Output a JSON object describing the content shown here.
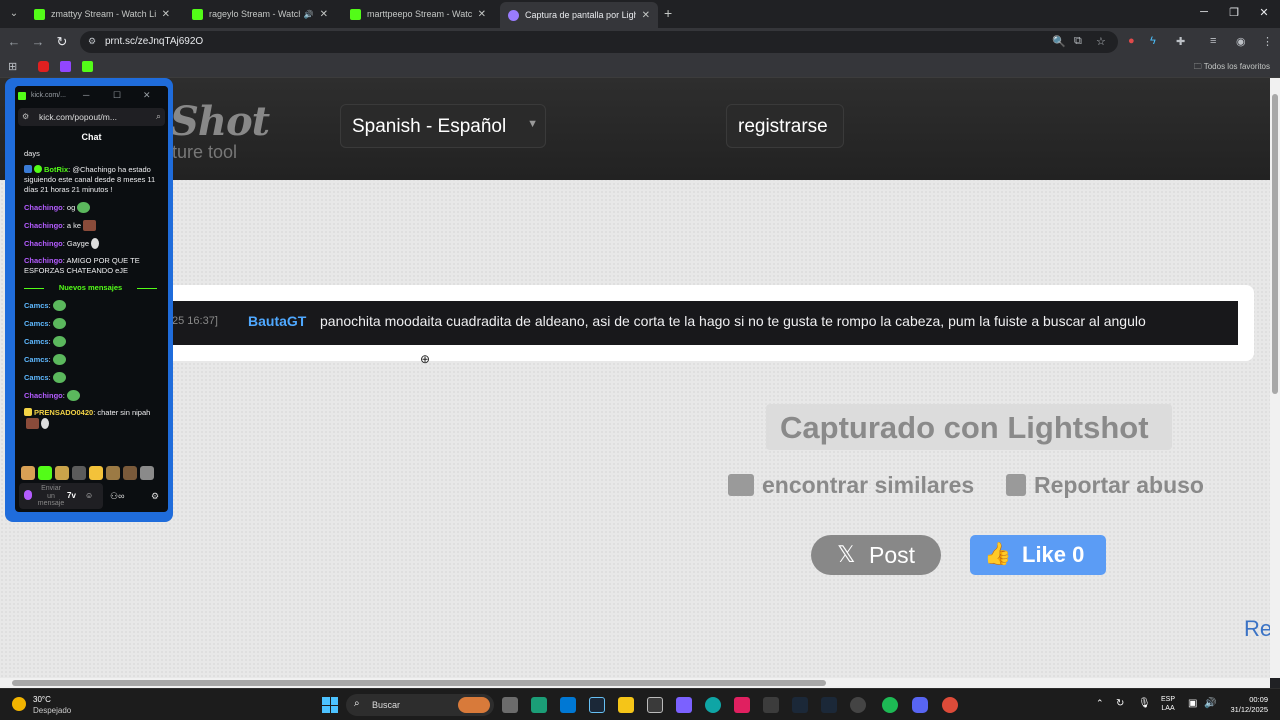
{
  "browser": {
    "tabs": [
      {
        "title": "zmattyy Stream - Watch Live on",
        "favicon": "kick-icon",
        "active": false
      },
      {
        "title": "rageylo Stream - Watch Live",
        "favicon": "kick-icon",
        "active": false,
        "audio": true
      },
      {
        "title": "marttpeepo Stream - Watch Live",
        "favicon": "kick-icon",
        "active": false
      },
      {
        "title": "Captura de pantalla por Lightshot",
        "favicon": "lightshot-icon",
        "active": true
      }
    ],
    "new_tab_symbol": "+",
    "url": "prnt.sc/zeJnqTAj692O",
    "bookmarks_all": "Todos los favoritos"
  },
  "page": {
    "logo_text": "Shot",
    "logo_sub": "ture tool",
    "language_button": "Spanish - Español",
    "register_button": "registrarse",
    "screenshot": {
      "timestamp": "25 16:37]",
      "username": "BautaGT",
      "message": "panochita moodaita cuadradita de aldeano, asi de corta te la hago si no te gusta te rompo la cabeza, pum la fuiste a buscar al angulo"
    },
    "captured_with": "Capturado con Lightshot",
    "find_similar": "encontrar similares",
    "report_abuse": "Reportar abuso",
    "post_label": "Post",
    "like_label": "Like",
    "like_count": "0",
    "partial_link": "Re"
  },
  "popout": {
    "title": "kick.com/...",
    "url": "kick.com/popout/m...",
    "chat_header": "Chat",
    "first_line": "days",
    "lines": [
      {
        "user": "BotRix",
        "text": ": @Chachingo ha estado siguiendo este canal desde 8 meses 11 días 21 horas 21 minutos !"
      },
      {
        "user": "Chachingo",
        "text": ": og"
      },
      {
        "user": "Chachingo",
        "text": ": a ke"
      },
      {
        "user": "Chachingo",
        "text": ": Gayge"
      },
      {
        "user": "Chachingo",
        "text": ": AMIGO POR QUE TE ESFORZAS CHATEANDO eJE"
      }
    ],
    "new_messages": "Nuevos mensajes",
    "after_lines": [
      {
        "user": "Camcs",
        "text": ":"
      },
      {
        "user": "Camcs",
        "text": ":"
      },
      {
        "user": "Camcs",
        "text": ":"
      },
      {
        "user": "Camcs",
        "text": ":"
      },
      {
        "user": "Camcs",
        "text": ":"
      },
      {
        "user": "Chachingo",
        "text": ":"
      },
      {
        "user": "PRENSADO0420",
        "text": ": chater sin nipah"
      }
    ],
    "input_placeholder": "Enviar un mensaje",
    "input_7tv": "7v"
  },
  "taskbar": {
    "temperature": "30°C",
    "weather": "Despejado",
    "search": "Buscar",
    "lang_line1": "ESP",
    "lang_line2": "LAA",
    "time": "00:09",
    "date": "31/12/2025"
  },
  "colors": {
    "kick_green": "#53fc18",
    "popout_border": "#1f6cdb",
    "like_blue": "#5b9cf5",
    "username_blue": "#4fa8ff"
  }
}
